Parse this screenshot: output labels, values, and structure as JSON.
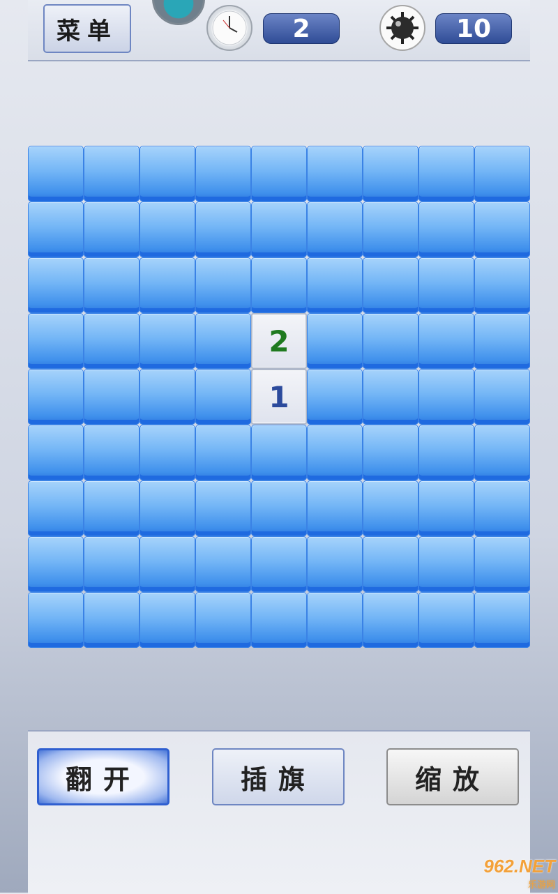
{
  "header": {
    "menu_label": "菜单",
    "timer_value": "2",
    "mines_value": "10",
    "clock_icon": "clock-icon",
    "mine_icon": "mine-icon",
    "mascot_icon": "mascot-icon"
  },
  "board": {
    "rows": 9,
    "cols": 9,
    "revealed": [
      {
        "row": 3,
        "col": 4,
        "value": "2",
        "color": "#1f7a1f"
      },
      {
        "row": 4,
        "col": 4,
        "value": "1",
        "color": "#2b4a9c"
      }
    ]
  },
  "toolbar": {
    "open_label": "翻开",
    "flag_label": "插旗",
    "zoom_label": "缩放"
  },
  "watermark": {
    "brand": "962.NET",
    "subtitle": "乐游网"
  }
}
